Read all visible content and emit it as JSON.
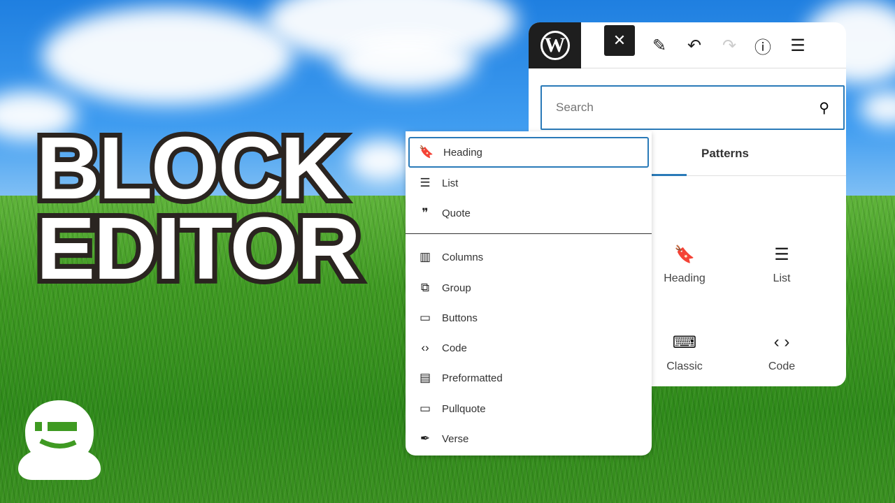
{
  "title": {
    "line1": "BLOCK",
    "line2": "EDITOR"
  },
  "toolbar": {
    "logo": "W",
    "close": "✕",
    "icons": [
      "close-icon",
      "pencil-icon",
      "undo-icon",
      "redo-icon",
      "info-icon",
      "list-view-icon"
    ]
  },
  "search": {
    "placeholder": "Search"
  },
  "tabs": {
    "patterns": "Patterns"
  },
  "grid": [
    {
      "label": "Heading",
      "icon": "bookmark-icon"
    },
    {
      "label": "List",
      "icon": "list-icon"
    },
    {
      "label": "Classic",
      "icon": "keyboard-icon"
    },
    {
      "label": "Code",
      "icon": "code-icon"
    }
  ],
  "menu": {
    "items": [
      {
        "label": "Heading",
        "icon": "bookmark-icon",
        "glyph": "🔖"
      },
      {
        "label": "List",
        "icon": "list-icon",
        "glyph": "☰"
      },
      {
        "label": "Quote",
        "icon": "quote-icon",
        "glyph": "❞"
      },
      {
        "label": "Columns",
        "icon": "columns-icon",
        "glyph": "▥"
      },
      {
        "label": "Group",
        "icon": "group-icon",
        "glyph": "⧉"
      },
      {
        "label": "Buttons",
        "icon": "buttons-icon",
        "glyph": "▭"
      },
      {
        "label": "Code",
        "icon": "code-icon",
        "glyph": "‹›"
      },
      {
        "label": "Preformatted",
        "icon": "preformatted-icon",
        "glyph": "▤"
      },
      {
        "label": "Pullquote",
        "icon": "pullquote-icon",
        "glyph": "▭"
      },
      {
        "label": "Verse",
        "icon": "feather-icon",
        "glyph": "✒"
      }
    ]
  },
  "colors": {
    "accent": "#2a7ab8",
    "dark": "#1e1e1e"
  }
}
